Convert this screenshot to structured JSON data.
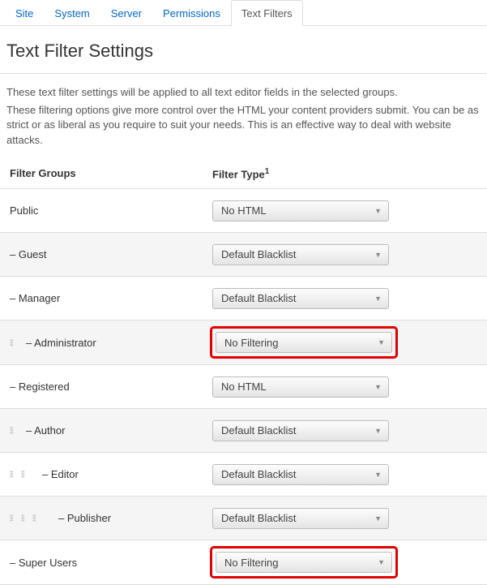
{
  "tabs": {
    "items": [
      "Site",
      "System",
      "Server",
      "Permissions",
      "Text Filters"
    ],
    "active_index": 4
  },
  "title": "Text Filter Settings",
  "description": {
    "line1": "These text filter settings will be applied to all text editor fields in the selected groups.",
    "line2": "These filtering options give more control over the HTML your content providers submit. You can be as strict or as liberal as you require to suit your needs. This is an effective way to deal with website attacks."
  },
  "table": {
    "headers": {
      "groups": "Filter Groups",
      "type": "Filter Type",
      "type_sup": "1"
    },
    "rows": [
      {
        "label": "Public",
        "indent": 0,
        "grips": 0,
        "value": "No HTML",
        "highlight": false
      },
      {
        "label": "– Guest",
        "indent": 0,
        "grips": 0,
        "value": "Default Blacklist",
        "highlight": false
      },
      {
        "label": "– Manager",
        "indent": 0,
        "grips": 0,
        "value": "Default Blacklist",
        "highlight": false
      },
      {
        "label": "– Administrator",
        "indent": 1,
        "grips": 1,
        "value": "No Filtering",
        "highlight": true
      },
      {
        "label": "– Registered",
        "indent": 0,
        "grips": 0,
        "value": "No HTML",
        "highlight": false
      },
      {
        "label": "– Author",
        "indent": 1,
        "grips": 1,
        "value": "Default Blacklist",
        "highlight": false
      },
      {
        "label": "– Editor",
        "indent": 2,
        "grips": 2,
        "value": "Default Blacklist",
        "highlight": false
      },
      {
        "label": "– Publisher",
        "indent": 3,
        "grips": 3,
        "value": "Default Blacklist",
        "highlight": false
      },
      {
        "label": "– Super Users",
        "indent": 0,
        "grips": 0,
        "value": "No Filtering",
        "highlight": true
      }
    ]
  }
}
